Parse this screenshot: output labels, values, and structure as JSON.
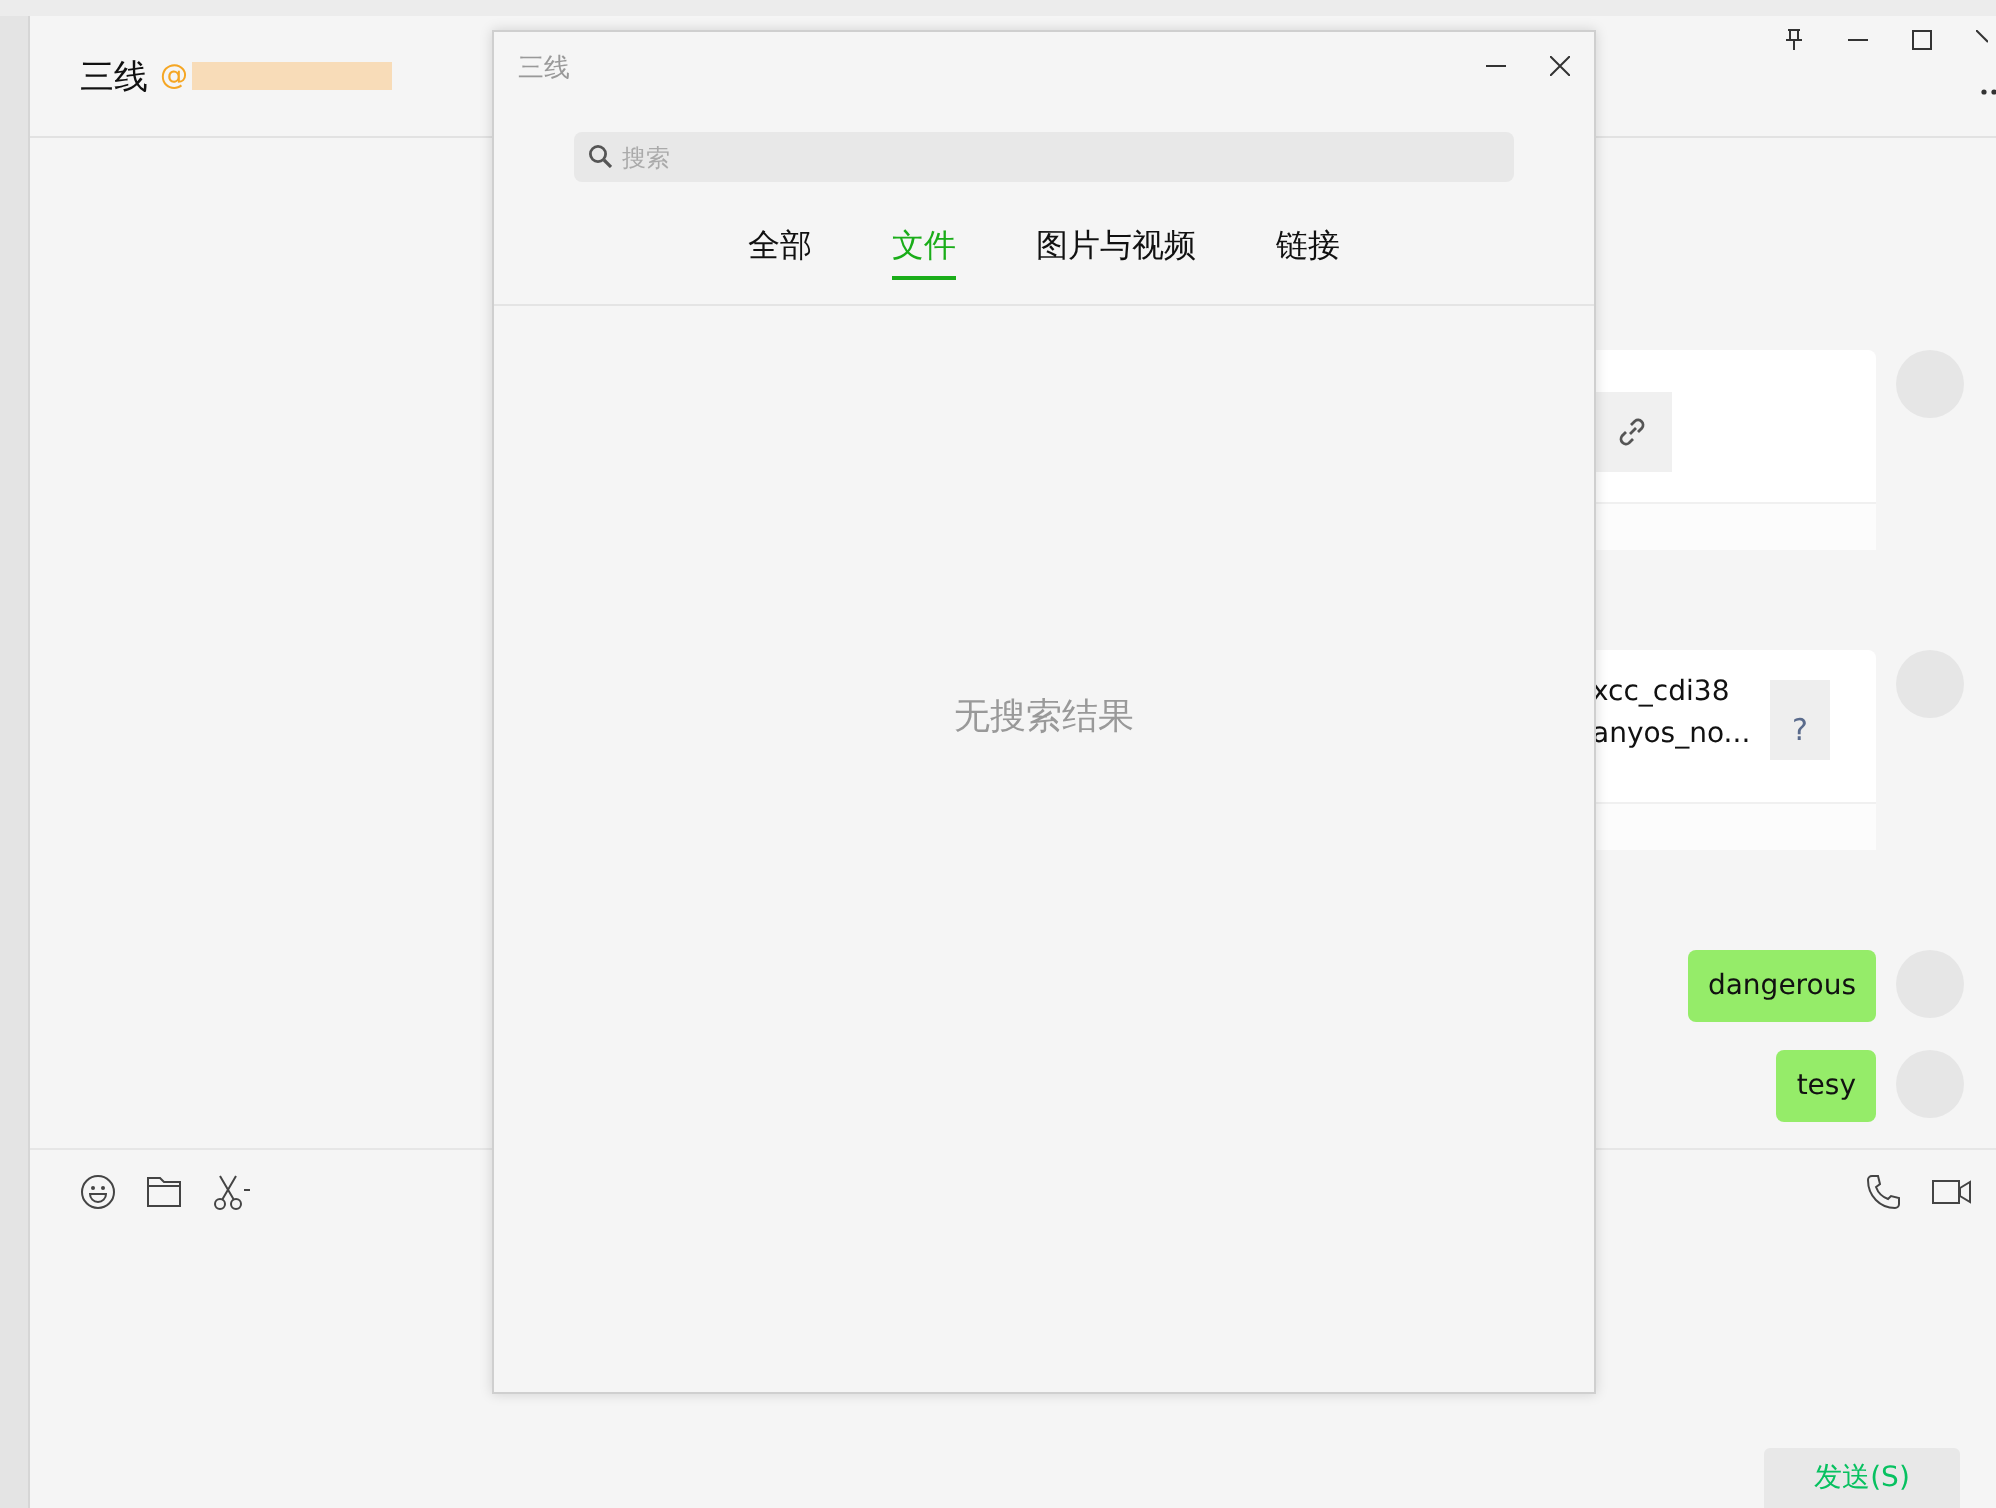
{
  "chat": {
    "title": "三线",
    "mention": "@"
  },
  "messages": [
    {
      "kind": "link_card"
    },
    {
      "kind": "file_card",
      "lines": [
        "xcc_cdi38",
        "anyos_no..."
      ],
      "file_icon": "?"
    },
    {
      "kind": "text",
      "text": "dangerous"
    },
    {
      "kind": "text",
      "text": "tesy"
    }
  ],
  "send_button": "发送(S)",
  "dialog": {
    "title": "三线",
    "search": {
      "placeholder": "搜索"
    },
    "tabs": [
      {
        "label": "全部",
        "selected": false
      },
      {
        "label": "文件",
        "selected": true
      },
      {
        "label": "图片与视频",
        "selected": false
      },
      {
        "label": "链接",
        "selected": false
      }
    ],
    "empty_message": "无搜索结果"
  }
}
